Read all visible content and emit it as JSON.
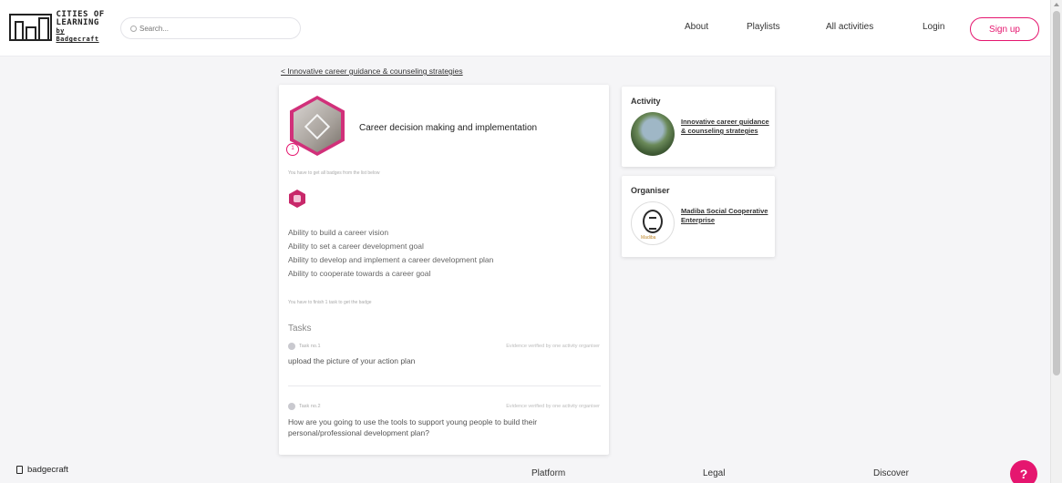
{
  "header": {
    "logo": {
      "line1": "CITIES OF",
      "line2": "LEARNING",
      "line3": "by Badgecraft"
    },
    "search_placeholder": "Search...",
    "nav": {
      "about": "About",
      "playlists": "Playlists",
      "all_activities": "All activities",
      "login": "Login",
      "signup": "Sign up"
    }
  },
  "breadcrumb": "< Innovative career guidance & counseling strategies",
  "badge": {
    "number": "1",
    "title": "Career decision making and implementation",
    "hint_all_badges": "You have to get all badges from the list below"
  },
  "skills": [
    "Ability to build a career vision",
    "Ability to set a career development goal",
    "Ability to develop and implement a career development plan",
    "Ability to cooperate towards a career goal"
  ],
  "hint_tasks": "You have to finish 1 task to get the badge",
  "tasks_title": "Tasks",
  "tasks": [
    {
      "label": "Task no.1",
      "verification": "Evidence verified by one activity organiser",
      "text": "upload the picture of your action plan"
    },
    {
      "label": "Task no.2",
      "verification": "Evidence verified by one activity organiser",
      "text": "How are you going to use the tools to support young people to build their personal/professional development plan?"
    }
  ],
  "activity": {
    "title": "Activity",
    "link": "Innovative career guidance & counseling strategies"
  },
  "organiser": {
    "title": "Organiser",
    "link": "Madiba Social Cooperative Enterprise",
    "logo_word": "Madiba"
  },
  "footer": {
    "brand": "badgecraft",
    "platform": "Platform",
    "legal": "Legal",
    "discover": "Discover",
    "help": "?"
  },
  "colors": {
    "accent": "#e5166f",
    "badge_border": "#d1307a"
  }
}
